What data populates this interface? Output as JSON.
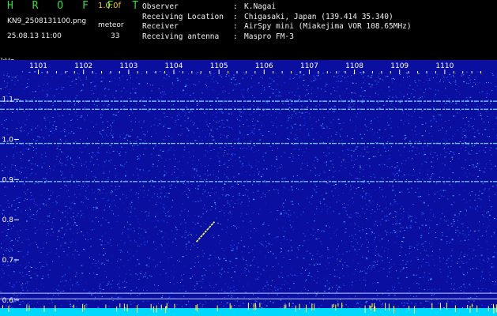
{
  "app": {
    "title": "H R O F F T",
    "version": "1.0.0f"
  },
  "file": {
    "name": "KN9_2508131100.png",
    "timestamp": "25.08.13 11:00"
  },
  "meteor": {
    "label": "meteor",
    "count": "33"
  },
  "station": [
    {
      "key": "Observer",
      "value": "K.Nagai"
    },
    {
      "key": "Receiving Location",
      "value": "Chigasaki, Japan (139.414 35.340)"
    },
    {
      "key": "Receiver",
      "value": "AirSpy mini (Miakejima VOR 108.65MHz)"
    },
    {
      "key": "Receiving antenna",
      "value": "Maspro FM-3"
    }
  ],
  "colors": {
    "background": "#0a0fa0",
    "tone_line": "#7fd8ff",
    "meteor_echo": "#ffff66",
    "bottom_band": "#00d8ff"
  },
  "chart_data": {
    "type": "heatmap",
    "yunit": "kHz",
    "time_ticks": [
      "1101",
      "1102",
      "1103",
      "1104",
      "1105",
      "1106",
      "1107",
      "1108",
      "1109",
      "1110"
    ],
    "freq_ticks": [
      "1.1",
      "1.0",
      "0.9",
      "0.8",
      "0.7",
      "0.6"
    ],
    "freq_range_khz": [
      0.58,
      1.17
    ],
    "time_range": [
      1100.5,
      1111
    ],
    "horizontal_tones_khz": [
      1.095,
      1.075,
      0.99,
      0.895
    ],
    "meteor_echoes": [
      {
        "t_start": 1104.5,
        "t_end": 1104.9,
        "f_start": 0.745,
        "f_end": 0.795
      }
    ]
  }
}
